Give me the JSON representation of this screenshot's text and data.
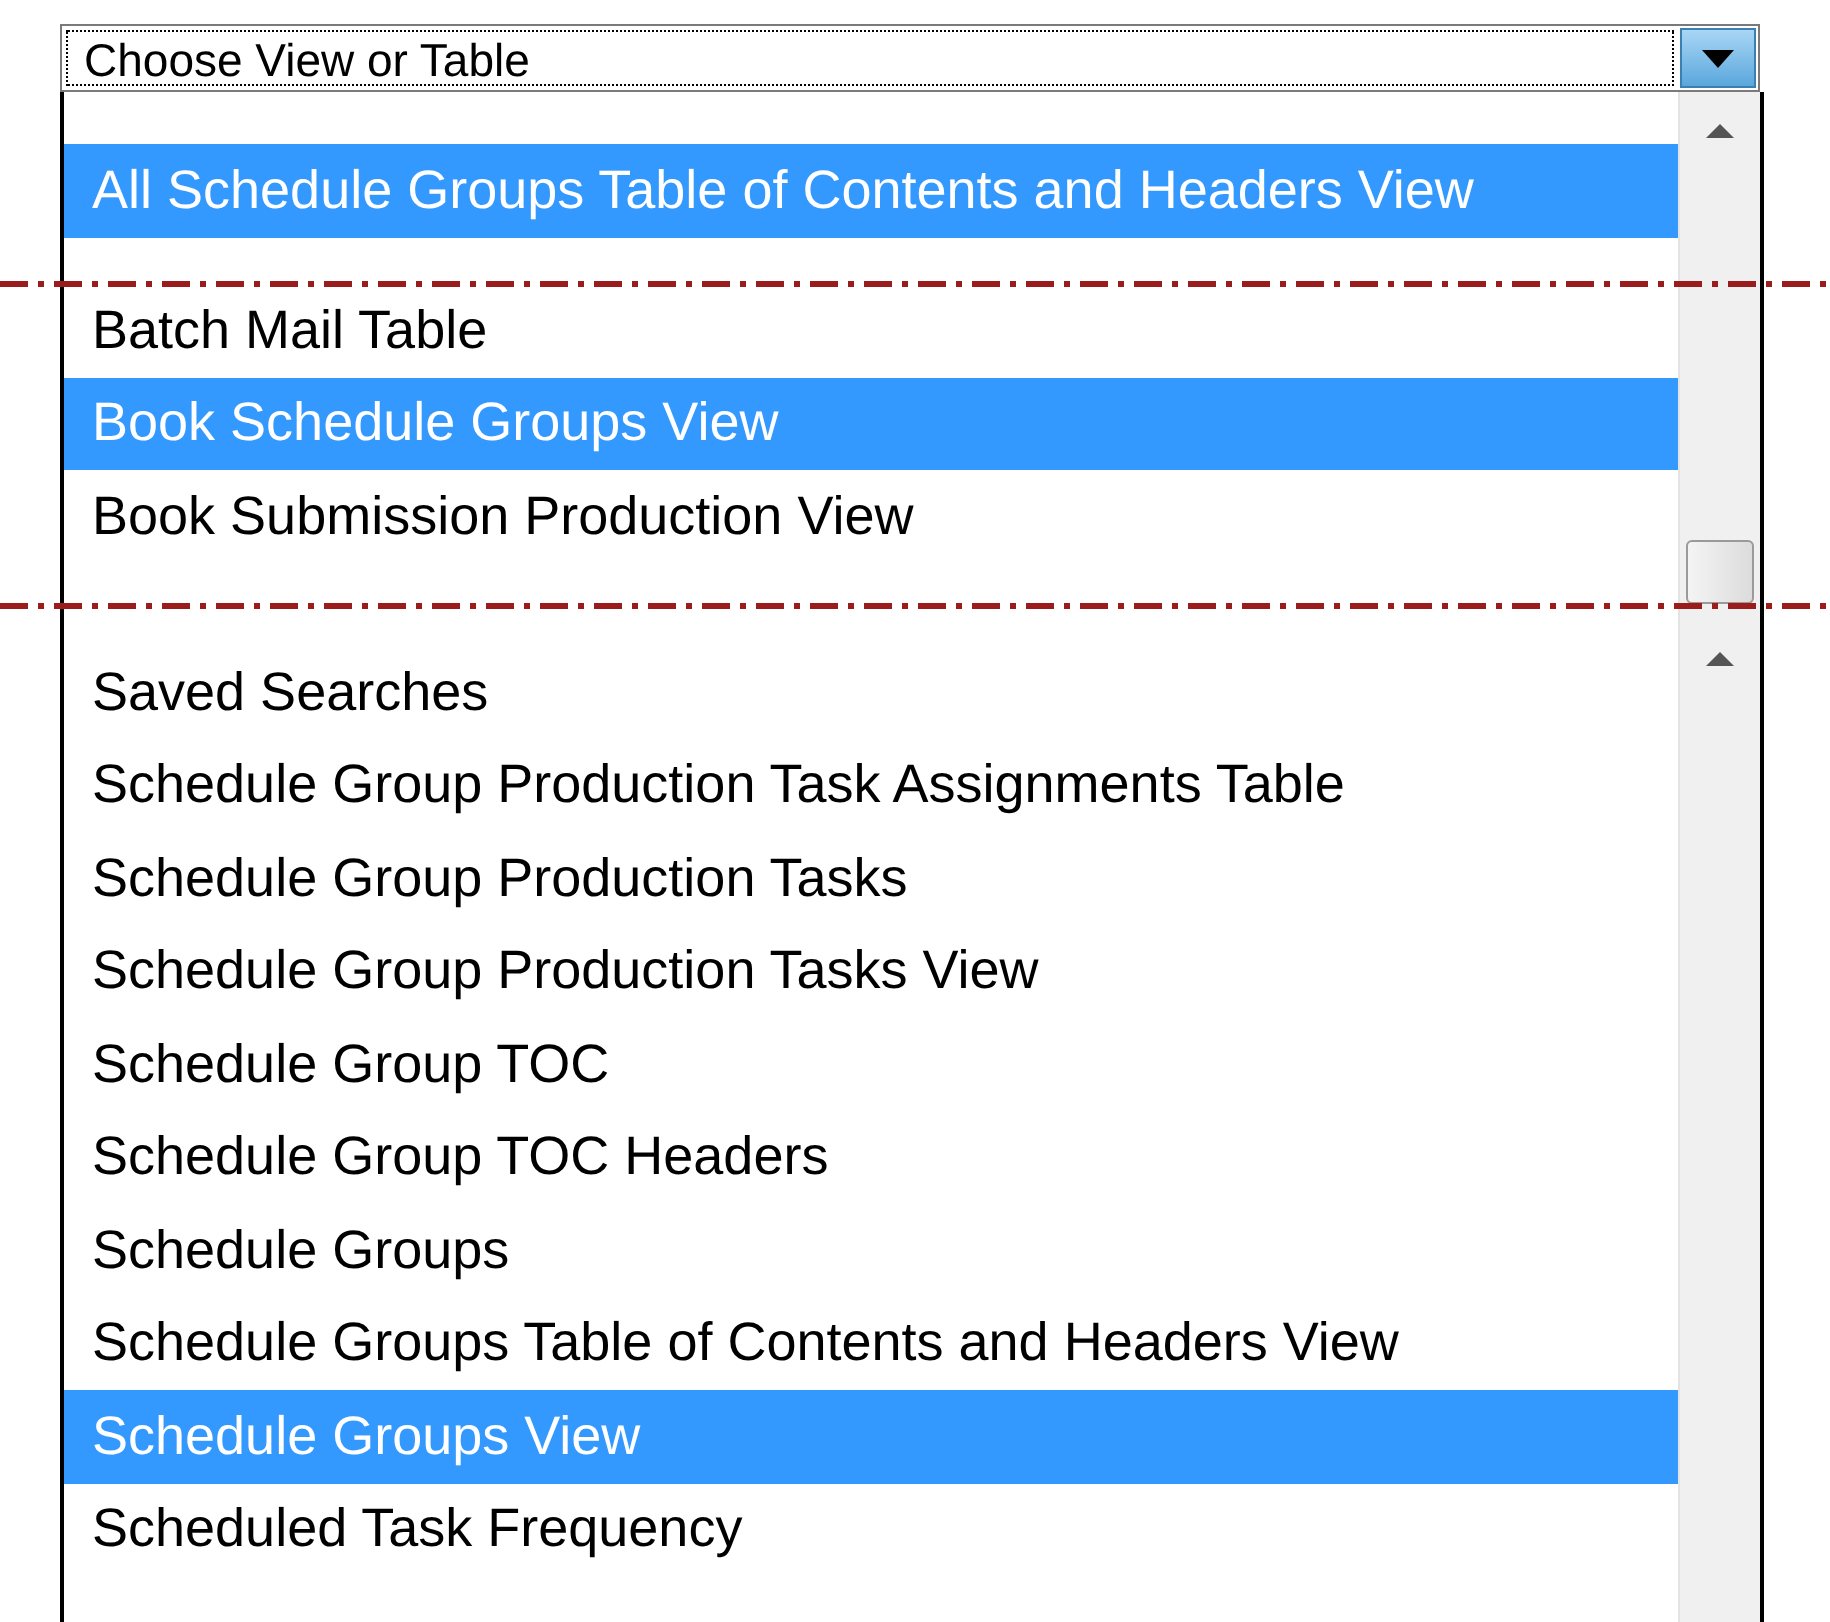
{
  "combo": {
    "value": "Choose View or Table"
  },
  "segments": [
    {
      "scrollbar": {
        "kind": "up_arrow"
      },
      "items": [
        {
          "label": "All Schedule Groups Table of Contents and Headers View",
          "selected": true
        }
      ]
    },
    {
      "scrollbar": {
        "kind": "thumb"
      },
      "items": [
        {
          "label": "Batch Mail Table",
          "selected": false
        },
        {
          "label": "Book Schedule Groups View",
          "selected": true
        },
        {
          "label": "Book Submission Production View",
          "selected": false
        }
      ]
    },
    {
      "scrollbar": {
        "kind": "up_arrow"
      },
      "items": [
        {
          "label": "Saved Searches",
          "selected": false
        },
        {
          "label": "Schedule Group Production Task Assignments Table",
          "selected": false
        },
        {
          "label": "Schedule Group Production Tasks",
          "selected": false
        },
        {
          "label": "Schedule Group Production Tasks View",
          "selected": false
        },
        {
          "label": "Schedule Group TOC",
          "selected": false
        },
        {
          "label": "Schedule Group TOC Headers",
          "selected": false
        },
        {
          "label": "Schedule Groups",
          "selected": false
        },
        {
          "label": "Schedule Groups Table of Contents and Headers View",
          "selected": false
        },
        {
          "label": "Schedule Groups View",
          "selected": true
        },
        {
          "label": "Scheduled Task Frequency",
          "selected": false
        }
      ]
    }
  ]
}
